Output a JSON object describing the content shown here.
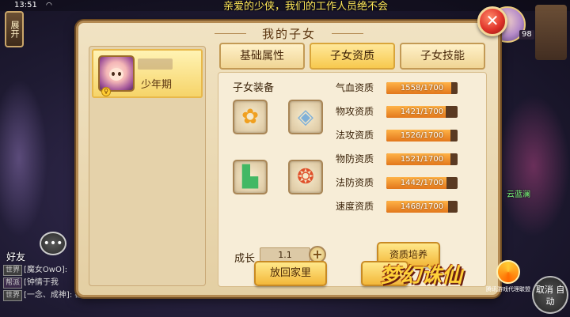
{
  "status": {
    "time": "13:51"
  },
  "marquee": "亲爱的少侠，我们的工作人员绝不会",
  "hud": {
    "expand_label": "展开",
    "level": "98",
    "friends_label": "好友",
    "cancel_auto_label": "取消 自动",
    "npc_name": "云蓝澜"
  },
  "chat": {
    "lines": [
      {
        "tag": "世界",
        "text": "[魔女OwO]:"
      },
      {
        "tag": "帮派",
        "text": "[钟情于我"
      },
      {
        "tag": "世界",
        "text": "[一念、成神]: 都是大神，都是工"
      }
    ]
  },
  "dialog": {
    "title": "我的子女",
    "tabs": [
      {
        "label": "基础属性",
        "active": false
      },
      {
        "label": "子女资质",
        "active": true
      },
      {
        "label": "子女技能",
        "active": false
      }
    ],
    "child": {
      "stage": "少年期"
    },
    "equipment_label": "子女装备",
    "equipment": [
      {
        "icon": "sunflower-icon"
      },
      {
        "icon": "armor-icon"
      },
      {
        "icon": "boots-icon"
      },
      {
        "icon": "amulet-icon"
      }
    ],
    "stats": [
      {
        "label": "气血资质",
        "value": "1558/1700",
        "current": 1558,
        "max": 1700
      },
      {
        "label": "物攻资质",
        "value": "1421/1700",
        "current": 1421,
        "max": 1700
      },
      {
        "label": "法攻资质",
        "value": "1526/1700",
        "current": 1526,
        "max": 1700
      },
      {
        "label": "物防资质",
        "value": "1521/1700",
        "current": 1521,
        "max": 1700
      },
      {
        "label": "法防资质",
        "value": "1442/1700",
        "current": 1442,
        "max": 1700
      },
      {
        "label": "速度资质",
        "value": "1468/1700",
        "current": 1468,
        "max": 1700
      }
    ],
    "growth_label": "成长",
    "growth_value": "1.1",
    "cultivate_label": "资质培养",
    "send_home_label": "放回家里"
  },
  "logo": {
    "text": "梦幻诛仙",
    "sub": "腾讯游戏代理联盟"
  },
  "colors": {
    "bar_fill": "#e2771b",
    "bar_bg": "#5a3a22",
    "close_red": "#e0332a",
    "gold_button": "#f3b83a"
  }
}
